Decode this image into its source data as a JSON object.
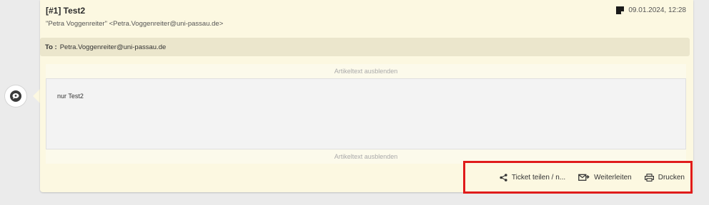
{
  "article": {
    "title": "[#1] Test2",
    "sender": "\"Petra Voggenreiter\" <Petra.Voggenreiter@uni-passau.de>",
    "datetime": "09.01.2024, 12:28",
    "recipient_label": "To :",
    "recipient": "Petra.Voggenreiter@uni-passau.de",
    "toggle_top": "Artikeltext ausblenden",
    "body": "nur Test2",
    "toggle_bottom": "Artikeltext ausblenden",
    "icons": {
      "avatar": "chat-bubble-icon",
      "datetime": "note-icon"
    }
  },
  "actions": [
    {
      "label": "Ticket teilen / n...",
      "icon": "share-icon"
    },
    {
      "label": "Weiterleiten",
      "icon": "forward-mail-icon"
    },
    {
      "label": "Drucken",
      "icon": "printer-icon"
    }
  ],
  "colors": {
    "highlight_border": "#e01b1b",
    "card_background": "#fcf8e1"
  }
}
